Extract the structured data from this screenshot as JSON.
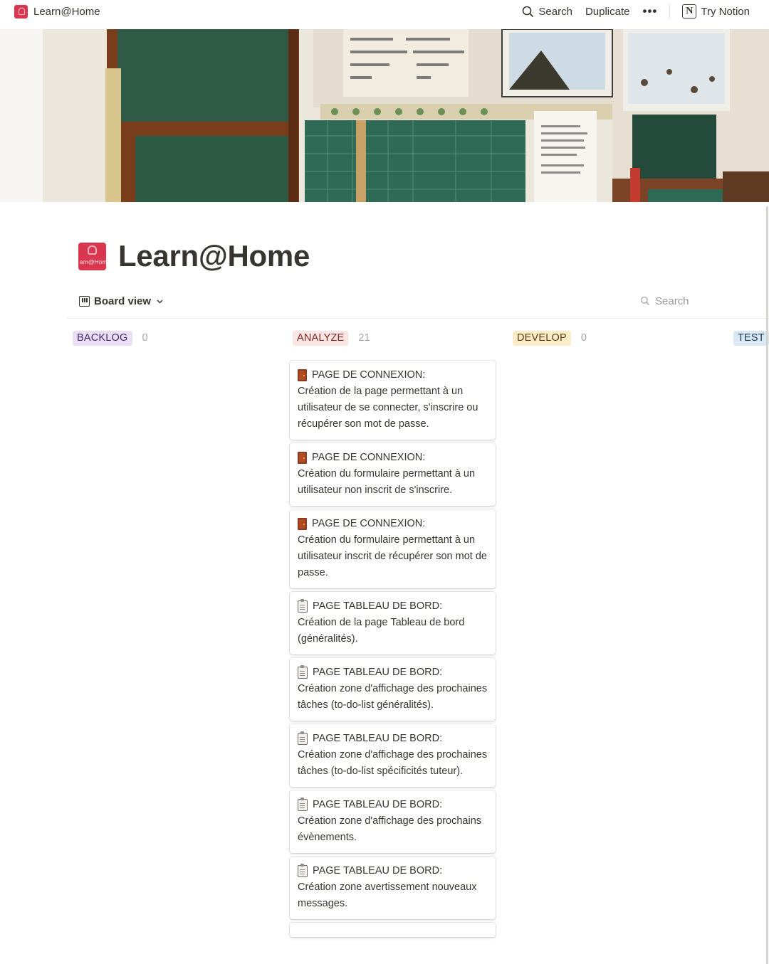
{
  "topbar": {
    "title": "Learn@Home",
    "search": "Search",
    "duplicate": "Duplicate",
    "more": "•••",
    "try_notion": "Try Notion"
  },
  "page": {
    "title": "Learn@Home",
    "icon_text": "arn@Hom"
  },
  "view": {
    "label": "Board view",
    "search_placeholder": "Search"
  },
  "columns": [
    {
      "name": "BACKLOG",
      "count": "0",
      "bg": "#eadff5",
      "fg": "#442a6b"
    },
    {
      "name": "ANALYZE",
      "count": "21",
      "bg": "#fbe4e4",
      "fg": "#7a2a22"
    },
    {
      "name": "DEVELOP",
      "count": "0",
      "bg": "#fdecc8",
      "fg": "#5c3b12"
    },
    {
      "name": "TEST",
      "count": "",
      "bg": "#d9e8f3",
      "fg": "#183b56"
    }
  ],
  "cards": [
    {
      "icon": "door-icon",
      "title": "PAGE DE CONNEXION:",
      "text": "Création de la page permettant à un utilisateur de se connecter, s'inscrire ou récupérer son mot de passe."
    },
    {
      "icon": "door-icon",
      "title": "PAGE DE CONNEXION:",
      "text": "Création du formulaire permettant à un utilisateur non inscrit de s'inscrire."
    },
    {
      "icon": "door-icon",
      "title": "PAGE DE CONNEXION:",
      "text": "Création du formulaire permettant à un utilisateur inscrit de récupérer son mot de passe."
    },
    {
      "icon": "clipboard-icon",
      "title": "PAGE TABLEAU DE BORD:",
      "text": "Création de la page Tableau de bord (généralités)."
    },
    {
      "icon": "clipboard-icon",
      "title": "PAGE TABLEAU DE BORD:",
      "text": "Création zone d'affichage des prochaines tâches (to-do-list généralités)."
    },
    {
      "icon": "clipboard-icon",
      "title": "PAGE TABLEAU DE BORD:",
      "text": "Création zone d'affichage des prochaines tâches (to-do-list spécificités tuteur)."
    },
    {
      "icon": "clipboard-icon",
      "title": "PAGE TABLEAU DE BORD:",
      "text": "Création zone d'affichage des prochains évènements."
    },
    {
      "icon": "clipboard-icon",
      "title": "PAGE TABLEAU DE BORD:",
      "text": "Création zone avertissement nouveaux messages."
    }
  ]
}
